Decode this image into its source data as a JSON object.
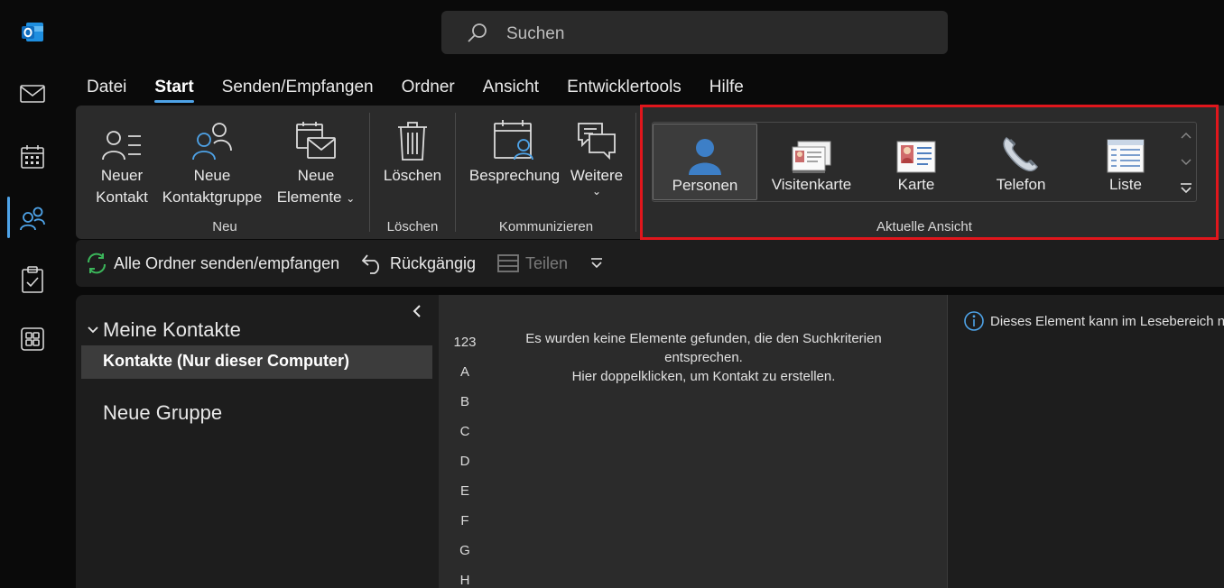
{
  "search": {
    "placeholder": "Suchen"
  },
  "tabs": [
    "Datei",
    "Start",
    "Senden/Empfangen",
    "Ordner",
    "Ansicht",
    "Entwicklertools",
    "Hilfe"
  ],
  "active_tab": "Start",
  "ribbon": {
    "neu": {
      "neuer_kontakt": [
        "Neuer",
        "Kontakt"
      ],
      "neue_kontaktgruppe": [
        "Neue",
        "Kontaktgruppe"
      ],
      "neue_elemente": [
        "Neue",
        "Elemente"
      ],
      "group_label": "Neu"
    },
    "loeschen": {
      "button": "Löschen",
      "group_label": "Löschen"
    },
    "kommunizieren": {
      "besprechung": "Besprechung",
      "weitere": "Weitere",
      "group_label": "Kommunizieren"
    },
    "aktuelle_ansicht": {
      "items": [
        "Personen",
        "Visitenkarte",
        "Karte",
        "Telefon",
        "Liste"
      ],
      "selected": "Personen",
      "group_label": "Aktuelle Ansicht"
    }
  },
  "qat": {
    "sync": "Alle Ordner senden/empfangen",
    "undo": "Rückgängig",
    "share": "Teilen"
  },
  "folders": {
    "header": "Meine Kontakte",
    "selected": "Kontakte (Nur dieser Computer)",
    "group": "Neue Gruppe"
  },
  "list": {
    "index": [
      "123",
      "A",
      "B",
      "C",
      "D",
      "E",
      "F",
      "G",
      "H"
    ],
    "empty_line1": "Es wurden keine Elemente gefunden, die den Suchkriterien",
    "empty_line2": "entsprechen.",
    "empty_line3": "Hier doppelklicken, um Kontakt zu erstellen."
  },
  "reading": {
    "info": "Dieses Element kann im Lesebereich n"
  },
  "colors": {
    "accent": "#4ea3e8",
    "highlight": "#e0161c",
    "outlook_blue": "#0f6cbd"
  }
}
